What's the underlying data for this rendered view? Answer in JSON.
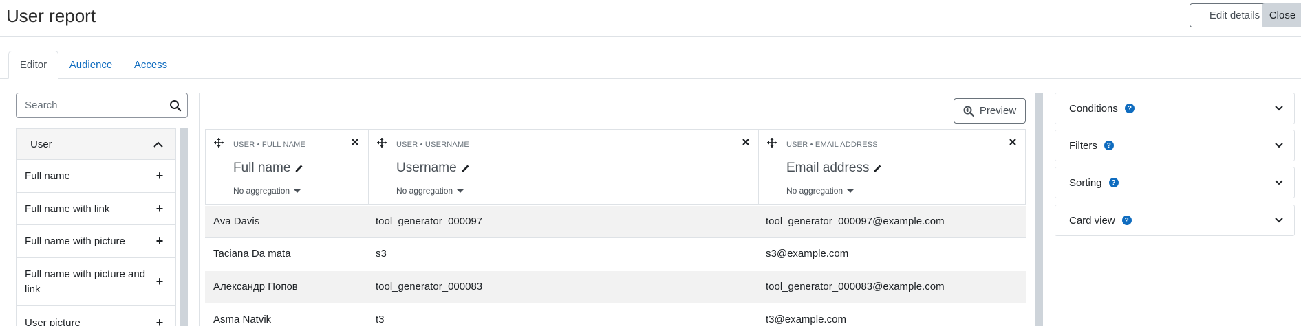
{
  "header": {
    "title": "User report",
    "edit_label": "Edit details",
    "close_label": "Close"
  },
  "tabs": [
    {
      "label": "Editor"
    },
    {
      "label": "Audience"
    },
    {
      "label": "Access"
    }
  ],
  "sidebar": {
    "search_placeholder": "Search",
    "category": "User",
    "items": [
      {
        "label": "Full name"
      },
      {
        "label": "Full name with link"
      },
      {
        "label": "Full name with picture"
      },
      {
        "label": "Full name with picture and link"
      },
      {
        "label": "User picture"
      }
    ]
  },
  "preview_label": "Preview",
  "columns": [
    {
      "source": "USER • FULL NAME",
      "title": "Full name",
      "aggregation": "No aggregation"
    },
    {
      "source": "USER • USERNAME",
      "title": "Username",
      "aggregation": "No aggregation"
    },
    {
      "source": "USER • EMAIL ADDRESS",
      "title": "Email address",
      "aggregation": "No aggregation"
    }
  ],
  "rows": [
    {
      "name": "Ava Davis",
      "username": "tool_generator_000097",
      "email": "tool_generator_000097@example.com"
    },
    {
      "name": "Taciana Da mata",
      "username": "s3",
      "email": "s3@example.com"
    },
    {
      "name": "Александр Попов",
      "username": "tool_generator_000083",
      "email": "tool_generator_000083@example.com"
    },
    {
      "name": "Asma Natvik",
      "username": "t3",
      "email": "t3@example.com"
    }
  ],
  "right_sections": [
    {
      "label": "Conditions"
    },
    {
      "label": "Filters"
    },
    {
      "label": "Sorting"
    },
    {
      "label": "Card view"
    }
  ],
  "colors": {
    "link": "#0f6cbf",
    "border": "#dee2e6",
    "stripe": "#f2f2f2",
    "scrollbar": "#ced4da"
  }
}
